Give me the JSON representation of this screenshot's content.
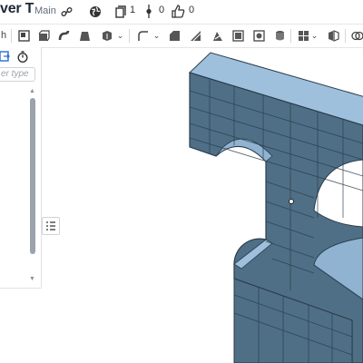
{
  "header": {
    "doc_title": "ver T",
    "branch": "Main",
    "versions_count": "1",
    "branches_count": "0",
    "likes_count": "0"
  },
  "panel": {
    "filter_placeholder": "er type"
  },
  "icons": [
    "link-icon",
    "globe-icon",
    "versions-icon",
    "branch-icon",
    "thumbs-up-icon",
    "sketch-icon",
    "timer-icon",
    "outline-list-icon"
  ],
  "colors": {
    "part_face": "#4f6f86",
    "part_top": "#9fc0dd",
    "grid_line": "#2b3d4c",
    "accent": "#2a6bd6"
  }
}
